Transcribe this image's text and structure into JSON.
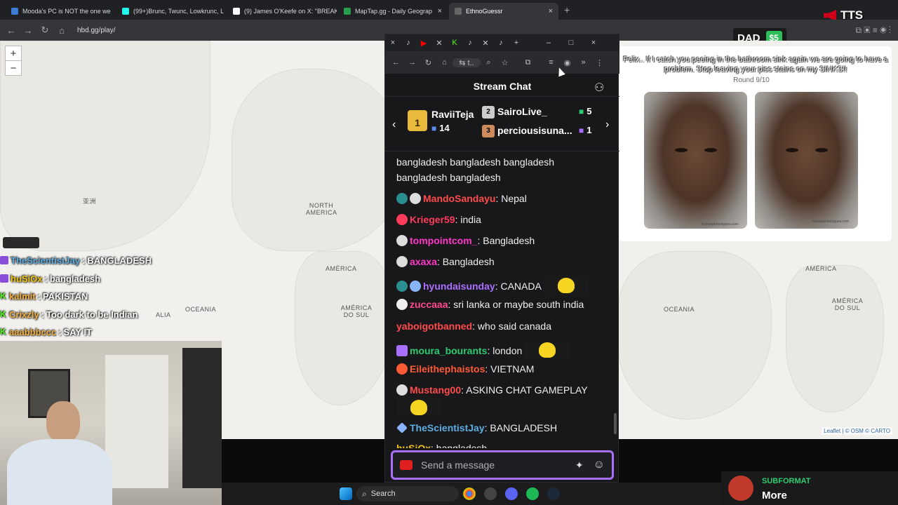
{
  "browser": {
    "tabs": [
      {
        "title": "Mooda's PC is NOT the one we",
        "color": "#3a7bd5"
      },
      {
        "title": "(99+)Brunc, Twunc, Lowkrunc, L",
        "color": "#25f4ee"
      },
      {
        "title": "(9) James O'Keefe on X: \"BREAK",
        "color": "#ffffff"
      },
      {
        "title": "MapTap.gg - Daily Geograp",
        "color": "#2a9d4a"
      },
      {
        "title": "EthnoGuessr",
        "color": "#666666"
      }
    ],
    "url": "hbd.gg/play/"
  },
  "overlay": {
    "tts": "TTS",
    "dad_label": "DAD",
    "dad_amount": "$5"
  },
  "map": {
    "zoom_in": "+",
    "zoom_out": "−",
    "labels": {
      "asia": "亚洲",
      "north_america": "NORTH AMERICA",
      "america_mid": "AMÉRICA",
      "do_sul": "AMÉRICA DO SUL",
      "oceania_left": "OCEANIA",
      "africa_left": "ALIA",
      "america_right": "AMÉRICA",
      "do_sul_right": "AMÉRICA DO SUL",
      "oceania_right": "OCEANIA"
    },
    "attribution": "Leaflet | © OSM © CARTO"
  },
  "stream_overlay_chat": [
    {
      "user": "TheScientistJay",
      "text": "BANGLADESH",
      "color": "#5dade2",
      "platform": "twitch"
    },
    {
      "user": "huSiOx",
      "text": "bangladesh",
      "color": "#f1c40f",
      "platform": "twitch"
    },
    {
      "user": "kalmit",
      "text": "PAKISTAN",
      "color": "#f5b041",
      "platform": "kick"
    },
    {
      "user": "Crixzly",
      "text": "Too dark to be Indian",
      "color": "#f5b041",
      "platform": "kick"
    },
    {
      "user": "aaabbbccc",
      "text": "SAY IT",
      "color": "#f5b041",
      "platform": "kick"
    }
  ],
  "game": {
    "message": "Felix.. If I catch you peeing in the bathroom sink again we are going to have a problem. Stop leaving your piss stains on my SINKS!!",
    "subtitle": "peeing in the bathroom sink",
    "round": "Round 9/10",
    "portrait_left_credit": "humanphenotypes.com",
    "portrait_right_credit": "humanphenotypes.com"
  },
  "chat_window": {
    "title": "Stream Chat",
    "gifters": [
      {
        "name": "RaviiTeja",
        "rank": "1",
        "count": "14"
      },
      {
        "name": "SairoLive_",
        "rank": "2",
        "count": "5"
      },
      {
        "name": "perciousisuna...",
        "rank": "3",
        "count": "1"
      }
    ],
    "messages": [
      {
        "user": "",
        "text": "bangladesh bangladesh bangladesh",
        "color": "#efeff1"
      },
      {
        "user": "",
        "text": "bangladesh bangladesh",
        "color": "#efeff1"
      },
      {
        "user": "MandoSandayu",
        "text": ": Nepal",
        "color": "#ff4b4b"
      },
      {
        "user": "Krieger59",
        "text": ": india",
        "color": "#ff3b5c"
      },
      {
        "user": "tompointcom_",
        "text": ": Bangladesh",
        "color": "#ff38c7"
      },
      {
        "user": "axaxa",
        "text": ": Bangladesh",
        "color": "#ff38c7"
      },
      {
        "user": "hyundaisunday",
        "text": ": CANADA",
        "color": "#a970ff"
      },
      {
        "user": "zuccaaa",
        "text": ": sri lanka or maybe south india",
        "color": "#ff4b8b"
      },
      {
        "user": "yaboigotbanned",
        "text": ": who said canada",
        "color": "#ff4b4b"
      },
      {
        "user": "moura_bourants",
        "text": ": london",
        "color": "#2ecc71"
      },
      {
        "user": "Eileithephaistos",
        "text": ": VIETNAM",
        "color": "#ff5a36"
      },
      {
        "user": "Mustang00",
        "text": ": ASKING CHAT GAMEPLAY",
        "color": "#ff4b4b"
      },
      {
        "user": "TheScientistJay",
        "text": ": BANGLADESH",
        "color": "#5dade2"
      },
      {
        "user": "huSiOx",
        "text": ": bangladesh",
        "color": "#f1c40f"
      }
    ],
    "input_placeholder": "Send a message"
  },
  "taskbar": {
    "search": "Search"
  },
  "subformat": {
    "name": "SUBFORMAT",
    "more": "More"
  }
}
